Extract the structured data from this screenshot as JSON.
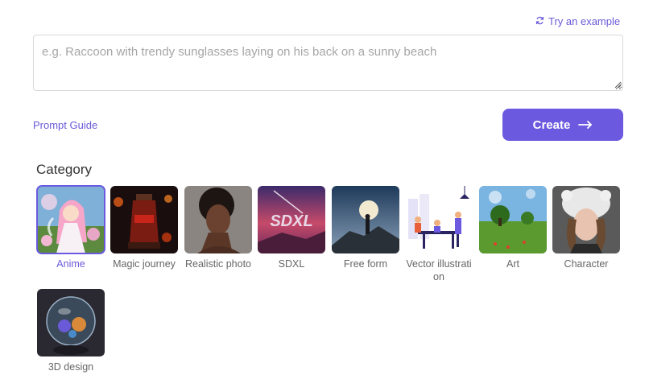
{
  "try_example": {
    "label": "Try an example",
    "icon": "refresh-icon"
  },
  "prompt": {
    "value": "",
    "placeholder": "e.g. Raccoon with trendy sunglasses laying on his back on a sunny beach"
  },
  "prompt_guide": {
    "label": "Prompt Guide"
  },
  "create_button": {
    "label": "Create",
    "icon": "arrow-right-icon"
  },
  "category": {
    "title": "Category",
    "selected": "Anime",
    "items": [
      {
        "label": "Anime"
      },
      {
        "label": "Magic journey"
      },
      {
        "label": "Realistic photo"
      },
      {
        "label": "SDXL"
      },
      {
        "label": "Free form"
      },
      {
        "label": "Vector illustration"
      },
      {
        "label": "Art"
      },
      {
        "label": "Character"
      },
      {
        "label": "3D design"
      }
    ]
  },
  "colors": {
    "accent": "#6b5ae0",
    "link": "#6a5ad8"
  }
}
